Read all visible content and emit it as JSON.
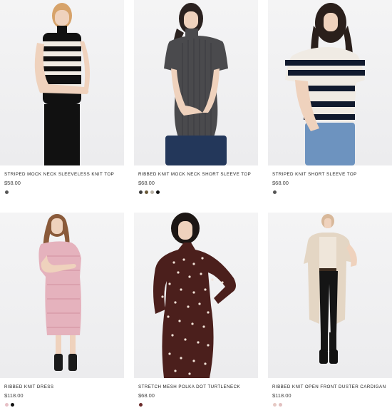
{
  "products": [
    {
      "name": "STRIPED MOCK NECK SLEEVELESS KNIT TOP",
      "price": "$58.00",
      "swatches": [
        "#555555"
      ]
    },
    {
      "name": "RIBBED KNIT MOCK NECK SHORT SLEEVE TOP",
      "price": "$68.00",
      "swatches": [
        "#3d3d3d",
        "#6b5a3a",
        "#b9b2a6",
        "#111111"
      ]
    },
    {
      "name": "STRIPED KNIT SHORT SLEEVE TOP",
      "price": "$68.00",
      "swatches": [
        "#555555"
      ]
    },
    {
      "name": "RIBBED KNIT DRESS",
      "price": "$118.00",
      "swatches": [
        "#e7c0c6",
        "#111111"
      ]
    },
    {
      "name": "STRETCH MESH POLKA DOT TURTLENECK",
      "price": "$68.00",
      "swatches": [
        "#6b2a2a"
      ]
    },
    {
      "name": "RIBBED KNIT OPEN FRONT DUSTER CARDIGAN",
      "price": "$118.00",
      "swatches": [
        "#e6c9c4",
        "#e2c0c0"
      ]
    }
  ]
}
